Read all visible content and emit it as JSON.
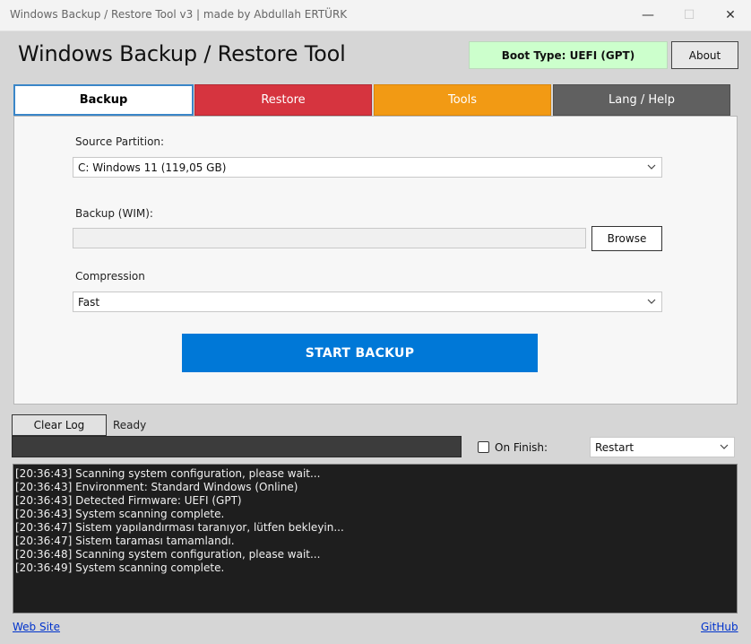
{
  "window": {
    "title": "Windows Backup / Restore Tool  v3 | made by Abdullah ERTÜRK",
    "minimize_glyph": "—",
    "maximize_glyph": "☐",
    "close_glyph": "✕"
  },
  "header": {
    "app_title": "Windows Backup / Restore Tool",
    "boot_type": "Boot Type: UEFI (GPT)",
    "about_label": "About"
  },
  "tabs": [
    {
      "label": "Backup",
      "color": "#ffffff"
    },
    {
      "label": "Restore",
      "color": "#d6343f"
    },
    {
      "label": "Tools",
      "color": "#f29a14"
    },
    {
      "label": "Lang / Help",
      "color": "#606060"
    }
  ],
  "backup": {
    "source_label": "Source Partition:",
    "source_value": "C: Windows 11 (119,05 GB)",
    "wim_label": "Backup (WIM):",
    "wim_value": "",
    "browse_label": "Browse",
    "compression_label": "Compression",
    "compression_value": "Fast",
    "start_label": "START BACKUP"
  },
  "footer_controls": {
    "clear_log_label": "Clear Log",
    "status_text": "Ready",
    "on_finish_label": "On Finish:",
    "on_finish_checked": false,
    "on_finish_value": "Restart"
  },
  "log": [
    "[20:36:43] Scanning system configuration, please wait...",
    "[20:36:43] Environment: Standard Windows (Online)",
    "[20:36:43] Detected Firmware: UEFI (GPT)",
    "[20:36:43] System scanning complete.",
    "[20:36:47] Sistem yapılandırması taranıyor, lütfen bekleyin...",
    "[20:36:47] Sistem taraması tamamlandı.",
    "[20:36:48] Scanning system configuration, please wait...",
    "[20:36:49] System scanning complete."
  ],
  "links": {
    "website": "Web Site",
    "github": "GitHub"
  },
  "colors": {
    "accent": "#0078d7",
    "boot_badge_bg": "#ccffcc",
    "log_bg": "#1e1e1e"
  }
}
